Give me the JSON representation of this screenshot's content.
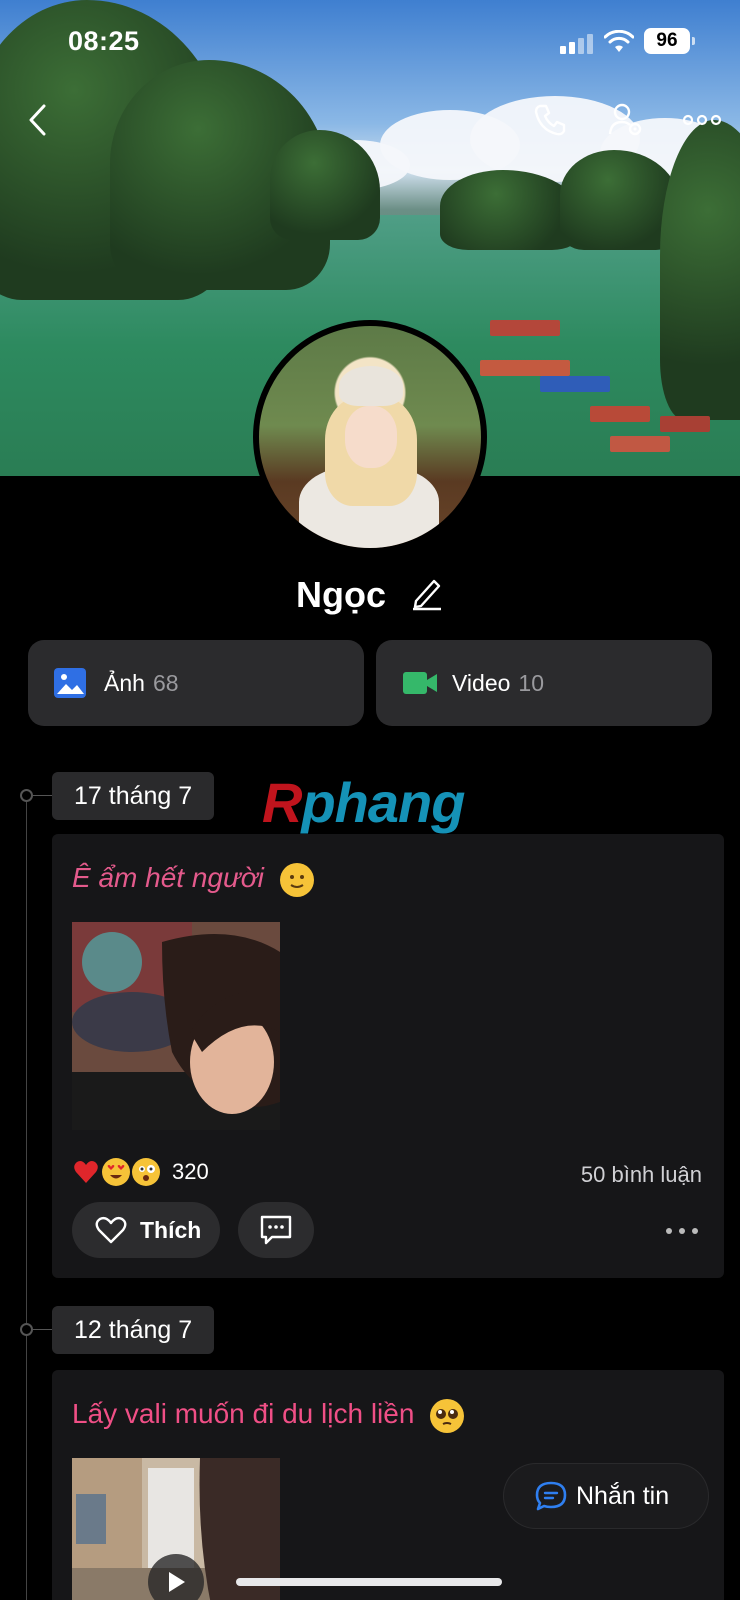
{
  "status_bar": {
    "time": "08:25",
    "battery": "96"
  },
  "profile": {
    "name": "Ngọc"
  },
  "media": {
    "photos_label": "Ảnh",
    "photos_count": "68",
    "videos_label": "Video",
    "videos_count": "10"
  },
  "watermark": {
    "first": "R",
    "rest": "phang"
  },
  "timeline": [
    {
      "date": "17 tháng 7",
      "text": "Ê ẩm hết người",
      "reaction_count": "320",
      "comments": "50 bình luận",
      "like_label": "Thích"
    },
    {
      "date": "12 tháng 7",
      "text": "Lấy vali muốn đi du lịch liền"
    }
  ],
  "message_button": {
    "label": "Nhắn tin"
  },
  "colors": {
    "post_text": "#e45a8c",
    "photos_icon": "#2f6fe4",
    "videos_icon": "#35b86a",
    "card_bg": "#2b2b2d"
  },
  "icons": [
    "back-icon",
    "phone-icon",
    "profile-settings-icon",
    "more-icon",
    "edit-icon",
    "photo-icon",
    "video-icon",
    "heart-icon",
    "comment-icon",
    "message-icon",
    "play-icon"
  ]
}
